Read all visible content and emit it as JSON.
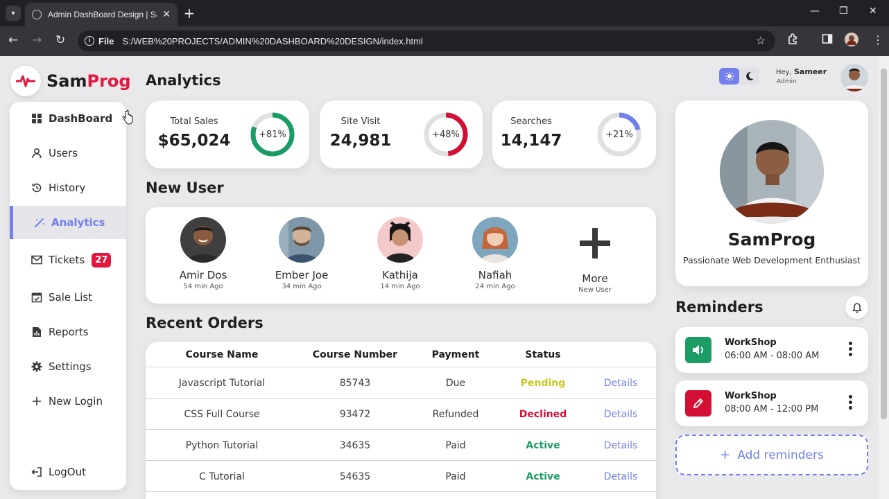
{
  "browser": {
    "tab_title": "Admin DashBoard Design | SamProg",
    "protocol_label": "File",
    "url": "S:/WEB%20PROJECTS/ADMIN%20DASHBOARD%20DESIGN/index.html"
  },
  "logo": {
    "part1": "Sam",
    "part2": "Prog"
  },
  "sidebar": {
    "items": [
      {
        "label": "DashBoard",
        "icon": "grid-icon"
      },
      {
        "label": "Users",
        "icon": "user-icon"
      },
      {
        "label": "History",
        "icon": "history-icon"
      },
      {
        "label": "Analytics",
        "icon": "wand-icon",
        "active": true
      },
      {
        "label": "Tickets",
        "icon": "mail-icon",
        "badge": "27"
      },
      {
        "label": "Sale List",
        "icon": "calendar-check-icon"
      },
      {
        "label": "Reports",
        "icon": "report-icon"
      },
      {
        "label": "Settings",
        "icon": "gear-icon"
      },
      {
        "label": "New Login",
        "icon": "plus-icon"
      },
      {
        "label": "LogOut",
        "icon": "logout-icon"
      }
    ]
  },
  "header": {
    "title": "Analytics",
    "greeting": "Hey,",
    "user_name": "Sameer",
    "user_role": "Admin"
  },
  "stats": [
    {
      "label": "Total Sales",
      "value": "$65,024",
      "percent_label": "+81%",
      "progress": 0.81,
      "color": "#1b9c64"
    },
    {
      "label": "Site Visit",
      "value": "24,981",
      "percent_label": "+48%",
      "progress": 0.48,
      "color": "#d31033"
    },
    {
      "label": "Searches",
      "value": "14,147",
      "percent_label": "+21%",
      "progress": 0.21,
      "color": "#7380ec"
    }
  ],
  "new_users": {
    "title": "New User",
    "users": [
      {
        "name": "Amir Dos",
        "time": "54 min Ago"
      },
      {
        "name": "Ember Joe",
        "time": "34 min Ago"
      },
      {
        "name": "Kathija",
        "time": "14 min Ago"
      },
      {
        "name": "Nafiah",
        "time": "24 min Ago"
      }
    ],
    "more": {
      "label": "More",
      "sub": "New User"
    }
  },
  "orders": {
    "title": "Recent Orders",
    "headers": [
      "Course Name",
      "Course Number",
      "Payment",
      "Status",
      ""
    ],
    "rows": [
      {
        "course": "Javascript Tutorial",
        "number": "85743",
        "payment": "Due",
        "status": "Pending",
        "status_color": "#c7c724",
        "action": "Details"
      },
      {
        "course": "CSS Full Course",
        "number": "93472",
        "payment": "Refunded",
        "status": "Declined",
        "status_color": "#d31033",
        "action": "Details"
      },
      {
        "course": "Python Tutorial",
        "number": "34635",
        "payment": "Paid",
        "status": "Active",
        "status_color": "#1b9c64",
        "action": "Details"
      },
      {
        "course": "C Tutorial",
        "number": "54635",
        "payment": "Paid",
        "status": "Active",
        "status_color": "#1b9c64",
        "action": "Details"
      }
    ]
  },
  "profile": {
    "name": "SamProg",
    "bio": "Passionate Web Development Enthusiast"
  },
  "reminders": {
    "title": "Reminders",
    "items": [
      {
        "title": "WorkShop",
        "time": "06:00 AM - 08:00 AM",
        "icon": "volume-icon",
        "color": "#1b9c64"
      },
      {
        "title": "WorkShop",
        "time": "08:00 AM - 12:00 PM",
        "icon": "edit-icon",
        "color": "#d31033"
      }
    ],
    "add_label": "Add reminders"
  },
  "colors": {
    "primary": "#7380ec",
    "danger": "#e3173f",
    "success": "#1b9c64",
    "warning": "#c7c724"
  }
}
